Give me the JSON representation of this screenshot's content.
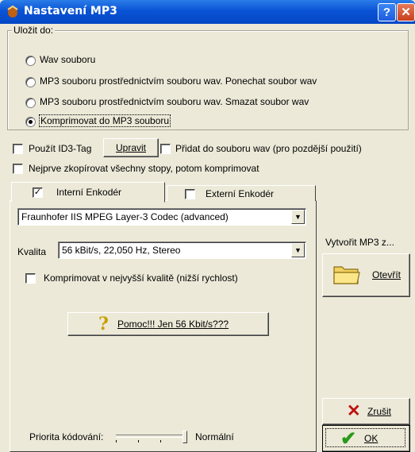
{
  "window": {
    "title": "Nastavení MP3",
    "help_glyph": "?",
    "close_glyph": "✕"
  },
  "save_group": {
    "label": "Uložit do:",
    "options": [
      {
        "label": "Wav souboru",
        "selected": false
      },
      {
        "label": "MP3 souboru prostřednictvím souboru wav. Ponechat soubor wav",
        "selected": false
      },
      {
        "label": "MP3 souboru prostřednictvím souboru wav. Smazat soubor wav",
        "selected": false
      },
      {
        "label": "Komprimovat do MP3 souboru",
        "selected": true
      }
    ]
  },
  "options": {
    "id3_label": "Použít ID3-Tag",
    "id3_checked": false,
    "edit_button": "Upravit",
    "add_to_wav_label": "Přidat do souboru wav (pro pozdější použití)",
    "add_to_wav_checked": false,
    "copy_first_label": "Nejprve zkopírovat všechny stopy, potom komprimovat",
    "copy_first_checked": false
  },
  "tabs": [
    {
      "label": "Interní Enkodér",
      "checked": true,
      "active": true
    },
    {
      "label": "Externí Enkodér",
      "checked": false,
      "active": false
    }
  ],
  "encoder": {
    "codec_value": "Fraunhofer IIS MPEG Layer-3 Codec (advanced)",
    "quality_label": "Kvalita",
    "quality_value": "56 kBit/s, 22,050 Hz, Stereo",
    "best_quality_label": "Komprimovat v nejvyšší kvalitě (nižší rychlost)",
    "best_quality_checked": false,
    "help_button": "Pomoc!!! Jen 56 Kbit/s???",
    "priority_label": "Priorita kódování:",
    "priority_value": "Normální"
  },
  "side": {
    "create_label": "Vytvořit MP3 z...",
    "open_button": "Otevřít",
    "cancel_button": "Zrušit",
    "ok_button": "OK"
  },
  "colors": {
    "titlebar": "#0a53d6",
    "dialog_bg": "#ece9d8",
    "help_icon": "#c8a000",
    "ok_check": "#2a9a1a",
    "cancel_x": "#c01010"
  }
}
